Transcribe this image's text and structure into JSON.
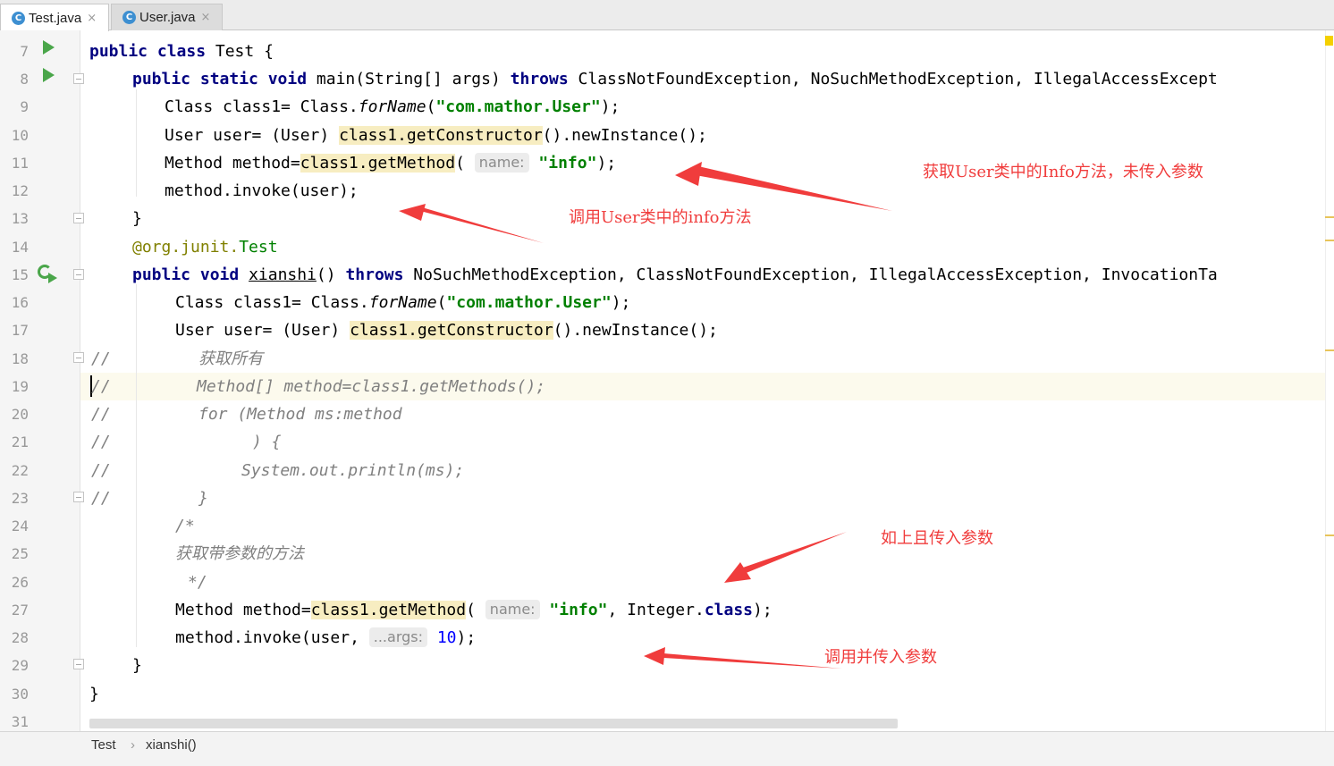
{
  "tabs": [
    {
      "label": "Test.java",
      "icon": "class-c-icon",
      "close": "×"
    },
    {
      "label": "User.java",
      "icon": "class-c-icon",
      "close": "×"
    }
  ],
  "icon_letter": "C",
  "line_numbers": [
    "7",
    "8",
    "9",
    "10",
    "11",
    "12",
    "13",
    "14",
    "15",
    "16",
    "17",
    "18",
    "19",
    "20",
    "21",
    "22",
    "23",
    "24",
    "25",
    "26",
    "27",
    "28",
    "29",
    "30",
    "31"
  ],
  "code": {
    "l7": {
      "kw1": "public class",
      "rest": " Test {"
    },
    "l8": {
      "kw1": "public static void",
      "t1": " main(String[] args) ",
      "kw2": "throws",
      "t2": " ClassNotFoundException, NoSuchMethodException, IllegalAccessExcept"
    },
    "l9": {
      "t1": "Class class1= Class.",
      "it": "forName",
      "t2": "(",
      "str": "\"com.mathor.User\"",
      "t3": ");"
    },
    "l10": {
      "t1": "User user= (User) ",
      "hl": "class1.getConstructor",
      "t2": "().newInstance();"
    },
    "l11": {
      "t1": "Method method=",
      "hl": "class1.getMethod",
      "t2": "( ",
      "hint": "name:",
      "t3": " ",
      "str": "\"info\"",
      "t4": ");"
    },
    "l12": {
      "t1": "method.invoke(user);"
    },
    "l13": {
      "t1": "}"
    },
    "l14": {
      "ann": "@org.junit.",
      "annname": "Test"
    },
    "l15": {
      "kw1": "public void",
      "t1": " ",
      "link": "xianshi",
      "t2": "() ",
      "kw2": "throws",
      "t3": " NoSuchMethodException, ClassNotFoundException, IllegalAccessException, InvocationTa"
    },
    "l16": {
      "t1": "Class class1= Class.",
      "it": "forName",
      "t2": "(",
      "str": "\"com.mathor.User\"",
      "t3": ");"
    },
    "l17": {
      "t1": "User user= (User) ",
      "hl": "class1.getConstructor",
      "t2": "().newInstance();"
    },
    "l18": {
      "c1": "//",
      "c2": "获取所有"
    },
    "l19": {
      "c1": "//",
      "c2": "Method[] method=class1.getMethods();"
    },
    "l20": {
      "c1": "//",
      "c2": "for (Method ms:method"
    },
    "l21": {
      "c1": "//",
      "c2": ") {"
    },
    "l22": {
      "c1": "//",
      "c2": "System.out.println(ms);"
    },
    "l23": {
      "c1": "//",
      "c2": "}"
    },
    "l24": {
      "c": "/*"
    },
    "l25": {
      "c": "获取带参数的方法"
    },
    "l26": {
      "c": "*/"
    },
    "l27": {
      "t1": "Method method=",
      "hl": "class1.getMethod",
      "t2": "( ",
      "hint": "name:",
      "t3": " ",
      "str": "\"info\"",
      "t4": ", Integer.",
      "kw": "class",
      "t5": ");"
    },
    "l28": {
      "t1": "method.invoke(user, ",
      "hint": "...args:",
      "t2": " ",
      "num": "10",
      "t3": ");"
    },
    "l29": {
      "t1": "}"
    },
    "l30": {
      "t1": "}"
    }
  },
  "annotations": {
    "a1": "获取User类中的Info方法，未传入参数",
    "a2": "调用User类中的info方法",
    "a3": "如上且传入参数",
    "a4": "调用并传入参数"
  },
  "breadcrumb": {
    "file": "Test",
    "sep": "›",
    "method": "xianshi()"
  },
  "colors": {
    "annotation": "#f03c3c",
    "keyword": "#000080",
    "string": "#008000",
    "run": "#4aa64a"
  }
}
